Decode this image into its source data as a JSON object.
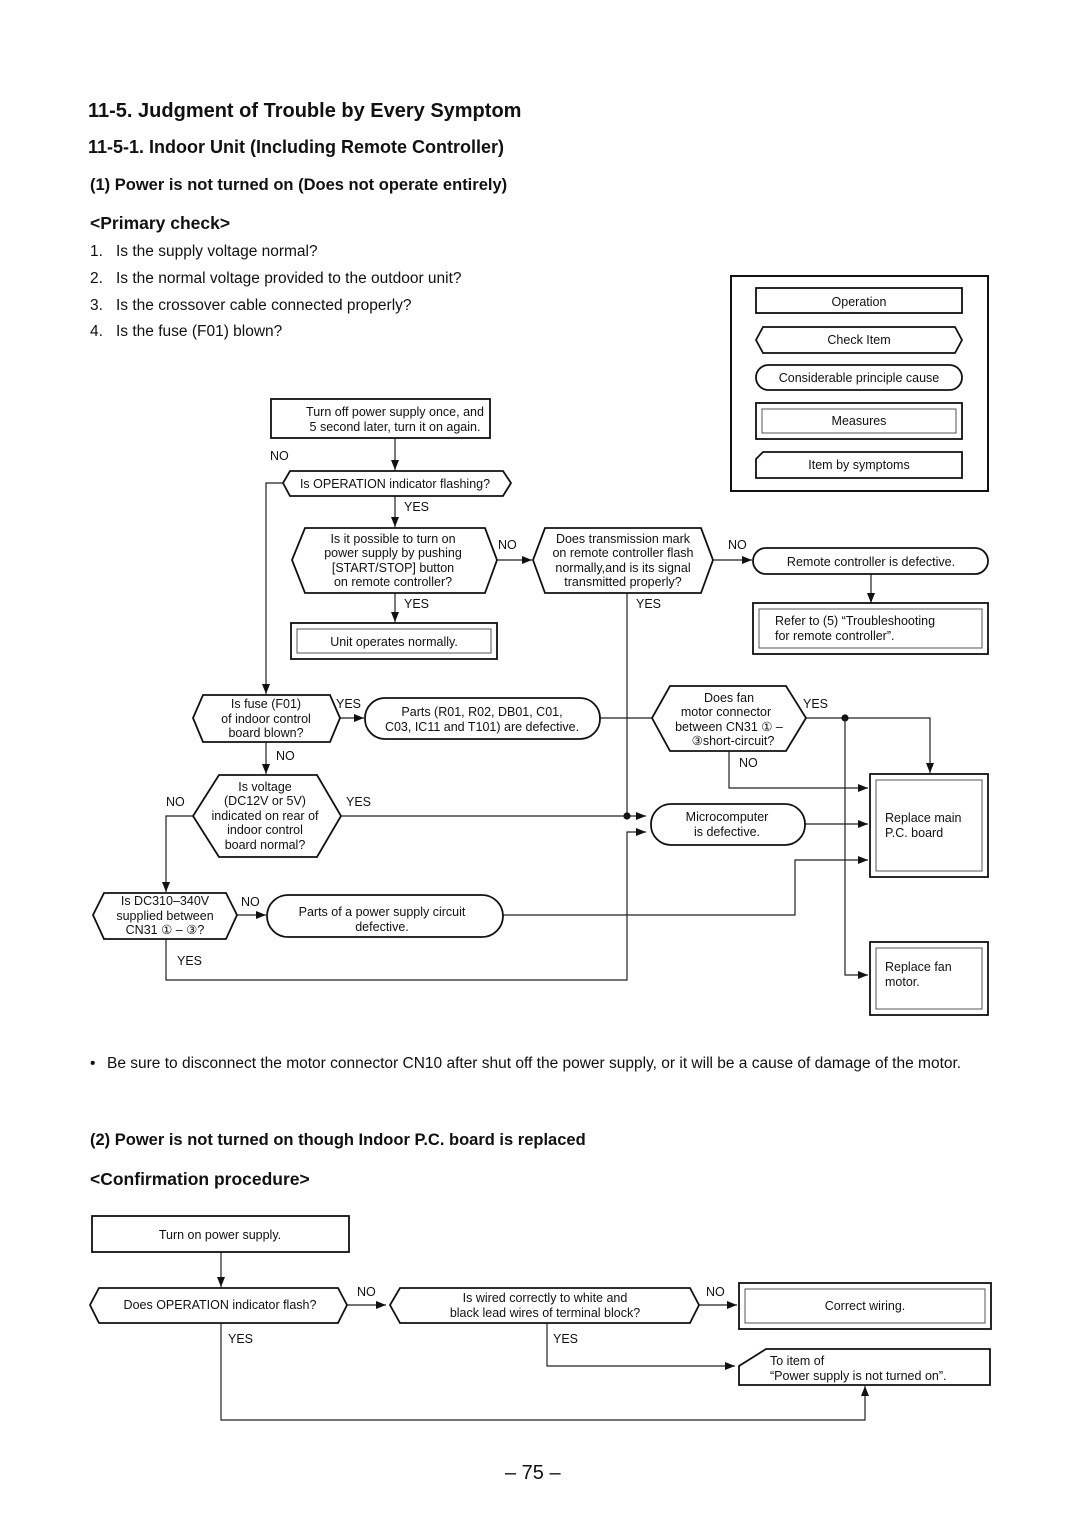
{
  "page": {
    "section_title": "11-5.  Judgment of Trouble by Every Symptom",
    "subsection_title": "11-5-1.  Indoor Unit (Including Remote Controller)",
    "item1_title": "(1)  Power is not turned on (Does not operate entirely)",
    "primary_check_heading": "<Primary check>",
    "primary_checks": [
      {
        "num": "1.",
        "text": "Is the supply voltage normal?"
      },
      {
        "num": "2.",
        "text": "Is the normal voltage provided to the outdoor unit?"
      },
      {
        "num": "3.",
        "text": "Is the crossover cable connected properly?"
      },
      {
        "num": "4.",
        "text": "Is the fuse (F01) blown?"
      }
    ],
    "note_bullet": "•",
    "note_text": "Be sure to disconnect the motor connector CN10 after shut off the power supply, or it will be a cause of damage of the motor.",
    "item2_title": "(2)  Power is not turned on though Indoor P.C. board is replaced",
    "confirmation_heading": "<Confirmation procedure>",
    "page_number": "– 75 –"
  },
  "legend": {
    "operation": "Operation",
    "check_item": "Check Item",
    "cause": "Considerable principle cause",
    "measures": "Measures",
    "item_by_symptoms": "Item by symptoms"
  },
  "flow1": {
    "turn_off": [
      "Turn off power supply once, and",
      "5 second later, turn it on again."
    ],
    "q_operation_flashing": [
      "Is OPERATION indicator flashing?"
    ],
    "q_start_stop": [
      "Is it possible to turn on",
      "power supply by pushing",
      "[START/STOP] button",
      "on remote controller?"
    ],
    "q_transmission": [
      "Does transmission mark",
      "on remote controller flash",
      "normally,and is its signal",
      "transmitted properly?"
    ],
    "remote_defective": [
      "Remote controller is defective."
    ],
    "refer_remote": [
      "Refer to (5) “Troubleshooting",
      "for remote controller”."
    ],
    "unit_normal": [
      "Unit operates normally."
    ],
    "q_fuse": [
      "Is fuse (F01)",
      "of indoor control",
      "board blown?"
    ],
    "parts_defective": [
      "Parts (R01, R02, DB01, C01,",
      "C03, IC11 and T101) are defective."
    ],
    "q_fan_motor": [
      "Does fan",
      "motor connector",
      "between CN31 ① –",
      "③short-circuit?"
    ],
    "q_voltage": [
      "Is voltage",
      "(DC12V or 5V)",
      "indicated on rear of",
      "indoor control",
      "board normal?"
    ],
    "micro_defective": [
      "Microcomputer",
      "is defective."
    ],
    "replace_main": [
      "Replace main",
      "P.C. board"
    ],
    "q_dc310": [
      "Is DC310–340V",
      "supplied between",
      "CN31 ① – ③?"
    ],
    "power_circuit": [
      "Parts of a power supply circuit",
      "defective."
    ],
    "replace_fan": [
      "Replace fan",
      "motor."
    ],
    "labels": {
      "yes": "YES",
      "no": "NO"
    }
  },
  "flow2": {
    "turn_on": [
      "Turn on power supply."
    ],
    "q_flash": [
      "Does OPERATION indicator flash?"
    ],
    "q_wired": [
      "Is wired correctly to white and",
      "black lead wires of terminal block?"
    ],
    "correct_wiring": [
      "Correct wiring."
    ],
    "to_item": [
      "To item of",
      "“Power supply is not turned on”."
    ],
    "labels": {
      "yes": "YES",
      "no": "NO"
    }
  }
}
